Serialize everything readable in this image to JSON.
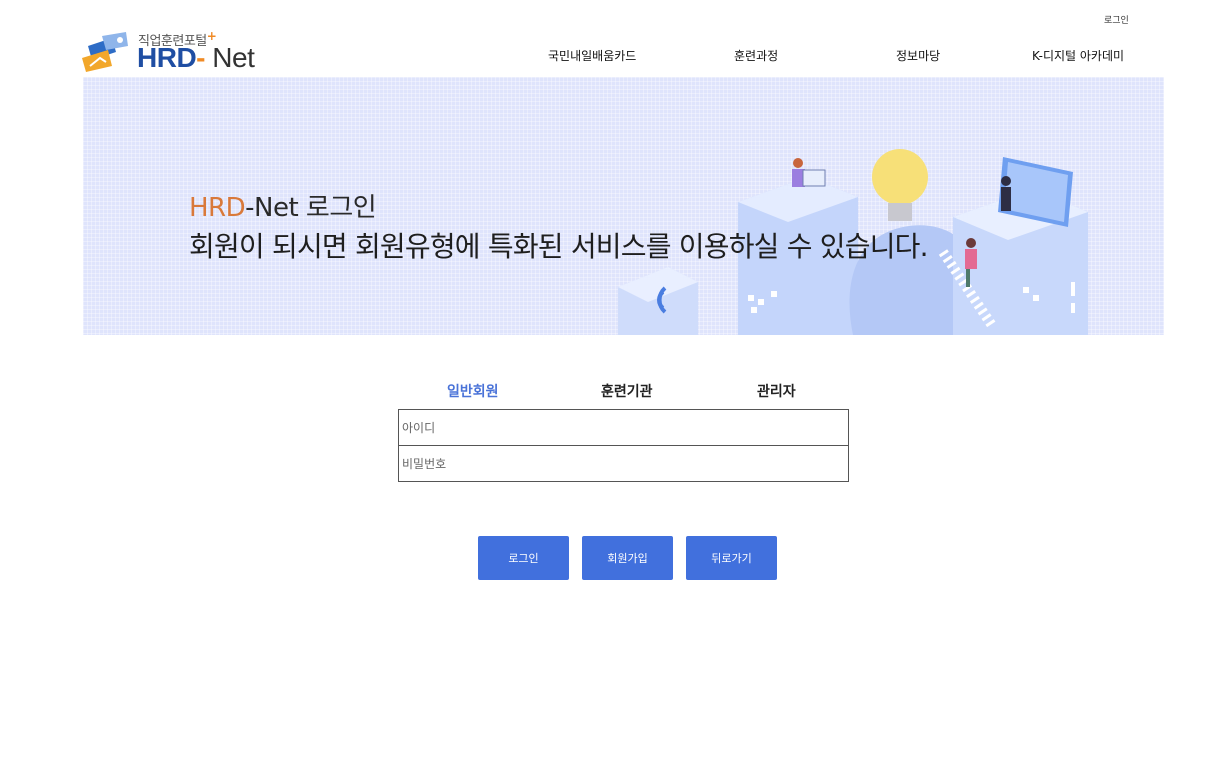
{
  "header": {
    "top_login_label": "로그인",
    "logo": {
      "subtitle": "직업훈련포털",
      "plus": "+",
      "name_hrd": "HRD",
      "name_dash": "-",
      "name_net": " Net"
    },
    "nav": [
      "국민내일배움카드",
      "훈련과정",
      "정보마당",
      "K-디지털 아카데미"
    ]
  },
  "banner": {
    "title_highlight": "HRD",
    "title_rest": "-Net 로그인",
    "description": "회원이 되시면 회원유형에 특화된 서비스를 이용하실 수 있습니다."
  },
  "login": {
    "tabs": [
      {
        "label": "일반회원",
        "active": true
      },
      {
        "label": "훈련기관",
        "active": false
      },
      {
        "label": "관리자",
        "active": false
      }
    ],
    "id_placeholder": "아이디",
    "password_placeholder": "비밀번호",
    "buttons": {
      "login": "로그인",
      "signup": "회원가입",
      "back": "뒤로가기"
    }
  },
  "colors": {
    "accent": "#4170dd",
    "active_tab": "#4a73d8",
    "brand_orange": "#f08a24",
    "brand_blue": "#1f4ea3",
    "banner_bg": "#dfe4fc"
  }
}
